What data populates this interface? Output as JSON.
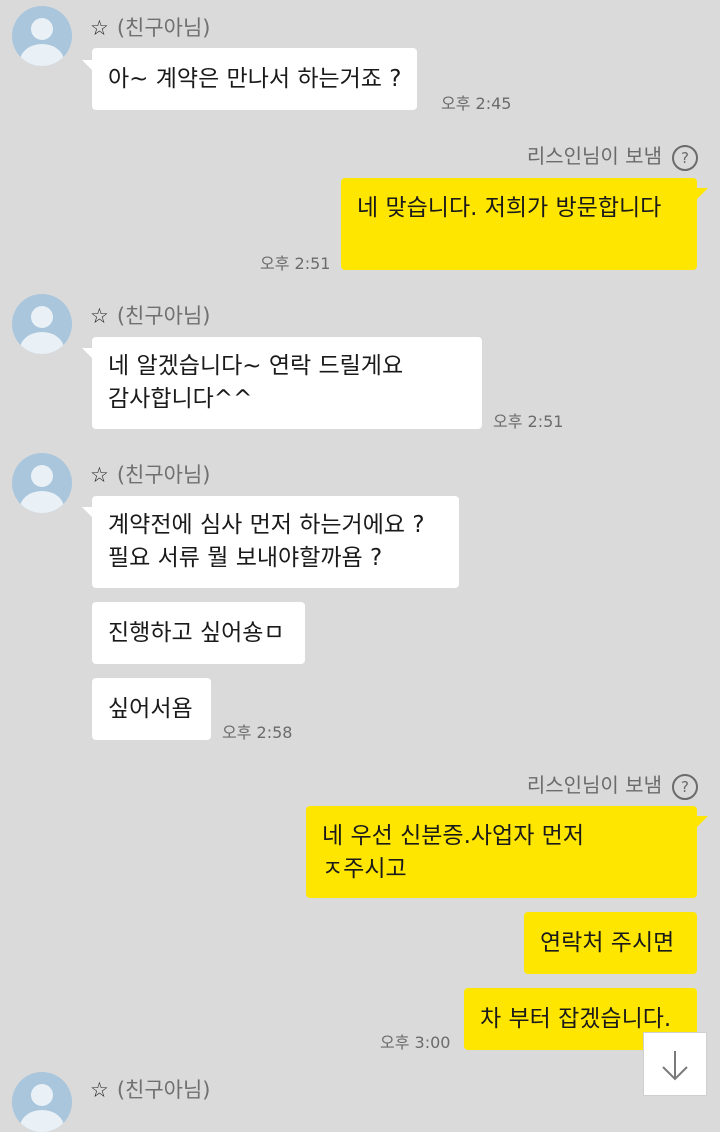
{
  "messages": [
    {
      "sender": "(친구아님)",
      "lines": [
        "아~ 계약은 만나서 하는거죠 ?"
      ],
      "time": "오후 2:45"
    },
    {
      "sent_label": "리스인님이 보냄",
      "lines": [
        "네 맞습니다. 저희가 방문합니다"
      ],
      "time": "오후 2:51"
    },
    {
      "sender": "(친구아님)",
      "lines": [
        "네 알겠습니다~ 연락 드릴게요",
        "감사합니다^^"
      ],
      "time": "오후 2:51"
    },
    {
      "sender": "(친구아님)",
      "bubbles": [
        [
          "계약전에 심사 먼저 하는거에요 ?",
          "필요 서류 뭘 보내야할까욤 ?"
        ],
        [
          "진행하고 싶어숑ㅁ"
        ],
        [
          "싶어서욤"
        ]
      ],
      "time": "오후 2:58"
    },
    {
      "sent_label": "리스인님이 보냄",
      "bubbles": [
        [
          "네 우선 신분증.사업자 먼저",
          "ㅈ주시고"
        ],
        [
          "연락처 주시면"
        ],
        [
          "차 부터 잡겠습니다."
        ]
      ],
      "time": "오후 3:00"
    },
    {
      "sender": "(친구아님)"
    }
  ],
  "icons": {
    "star": "star-outline-icon",
    "help": "question-circle-icon",
    "scroll": "arrow-down-icon"
  },
  "glyphs": {
    "star": "☆",
    "help": "?",
    "arrow": "↓"
  },
  "colors": {
    "background": "#dadada",
    "my_bubble": "#ffe600",
    "their_bubble": "#ffffff"
  }
}
